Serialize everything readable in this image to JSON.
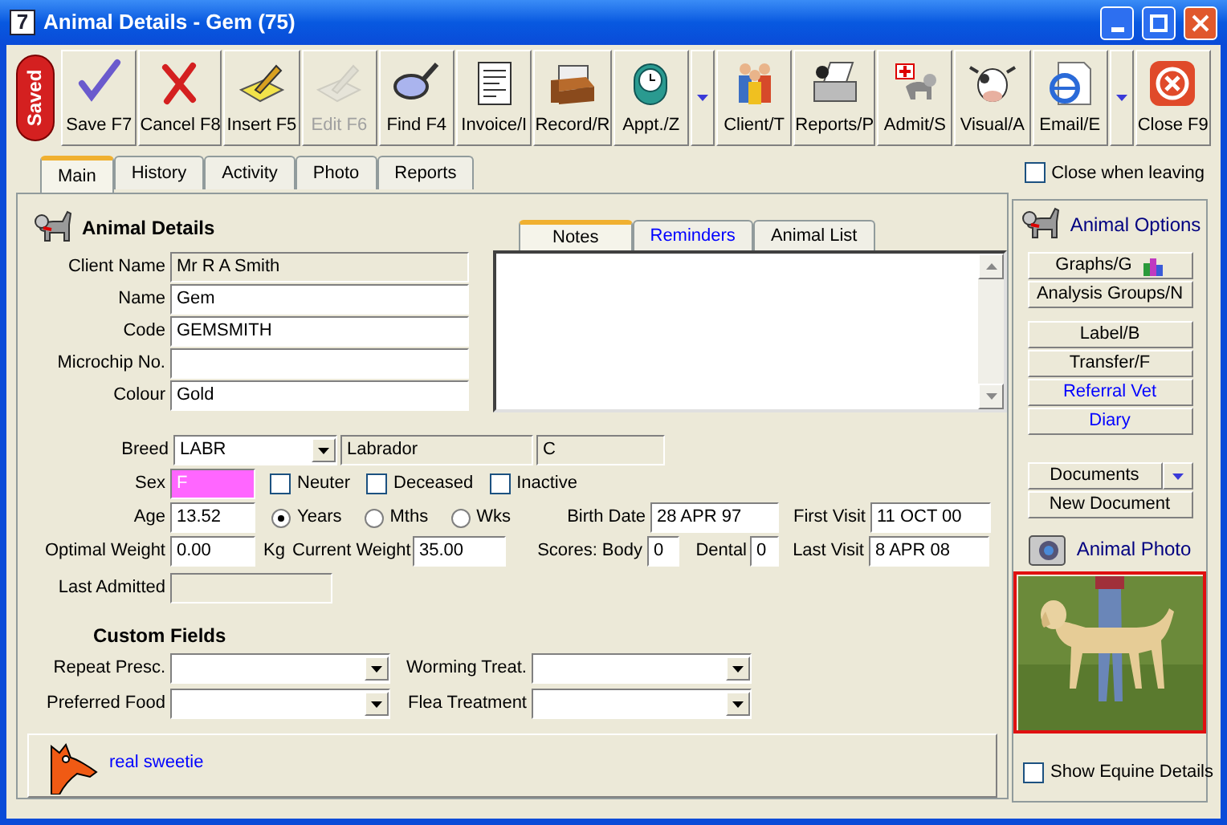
{
  "window": {
    "app_icon": "7",
    "title": "Animal Details - Gem (75)"
  },
  "toolbar": {
    "status": "Saved",
    "buttons": [
      {
        "label": "Save F7",
        "disabled": false,
        "menu": false
      },
      {
        "label": "Cancel F8",
        "disabled": false,
        "menu": false
      },
      {
        "label": "Insert F5",
        "disabled": false,
        "menu": false
      },
      {
        "label": "Edit F6",
        "disabled": true,
        "menu": false
      },
      {
        "label": "Find F4",
        "disabled": false,
        "menu": false
      },
      {
        "label": "Invoice/I",
        "disabled": false,
        "menu": false
      },
      {
        "label": "Record/R",
        "disabled": false,
        "menu": false
      },
      {
        "label": "Appt./Z",
        "disabled": false,
        "menu": true
      },
      {
        "label": "Client/T",
        "disabled": false,
        "menu": false
      },
      {
        "label": "Reports/P",
        "disabled": false,
        "menu": false
      },
      {
        "label": "Admit/S",
        "disabled": false,
        "menu": false
      },
      {
        "label": "Visual/A",
        "disabled": false,
        "menu": false
      },
      {
        "label": "Email/E",
        "disabled": false,
        "menu": true
      },
      {
        "label": "Close F9",
        "disabled": false,
        "menu": false
      }
    ]
  },
  "tabs": [
    {
      "label": "Main",
      "selected": true
    },
    {
      "label": "History",
      "selected": false
    },
    {
      "label": "Activity",
      "selected": false
    },
    {
      "label": "Photo",
      "selected": false
    },
    {
      "label": "Reports",
      "selected": false
    }
  ],
  "close_when_leaving": {
    "label": "Close when leaving",
    "checked": false
  },
  "animal_details": {
    "title": "Animal Details",
    "fields": [
      {
        "label": "Client Name",
        "value": "Mr R A Smith",
        "readonly": true
      },
      {
        "label": "Name",
        "value": "Gem",
        "readonly": false
      },
      {
        "label": "Code",
        "value": "GEMSMITH",
        "readonly": false
      },
      {
        "label": "Microchip No.",
        "readonly": false
      },
      {
        "label": "Colour",
        "value": "Gold",
        "readonly": false
      }
    ]
  },
  "notes": {
    "tabs": [
      {
        "label": "Notes",
        "selected": true,
        "link": false
      },
      {
        "label": "Reminders",
        "selected": false,
        "link": true
      },
      {
        "label": "Animal List",
        "selected": false,
        "link": false
      }
    ]
  },
  "breed": {
    "label": "Breed",
    "code": "LABR",
    "name": "Labrador",
    "group": "C"
  },
  "sex": {
    "label": "Sex",
    "value": "F",
    "female": true
  },
  "flags": [
    {
      "label": "Neuter",
      "checked": false
    },
    {
      "label": "Deceased",
      "checked": false
    },
    {
      "label": "Inactive",
      "checked": false
    }
  ],
  "age": {
    "label": "Age",
    "value": "13.52",
    "units": [
      {
        "label": "Years",
        "selected": true
      },
      {
        "label": "Mths",
        "selected": false
      },
      {
        "label": "Wks",
        "selected": false
      }
    ]
  },
  "birth_date": {
    "label": "Birth Date",
    "value": "28 APR 97"
  },
  "first_visit": {
    "label": "First Visit",
    "value": "11 OCT 00"
  },
  "optimal_weight": {
    "label": "Optimal Weight",
    "value": "0.00",
    "unit": "Kg"
  },
  "current_weight": {
    "label": "Current Weight",
    "value": "35.00"
  },
  "scores": {
    "body_label": "Scores: Body",
    "body": "0",
    "dental_label": "Dental",
    "dental": "0"
  },
  "last_visit": {
    "label": "Last Visit",
    "value": "8 APR 08"
  },
  "last_admitted": {
    "label": "Last Admitted",
    "readonly": true
  },
  "custom_fields": {
    "title": "Custom Fields",
    "fields": [
      {
        "label": "Repeat Presc."
      },
      {
        "label": "Worming Treat."
      },
      {
        "label": "Preferred Food"
      },
      {
        "label": "Flea Treatment"
      }
    ]
  },
  "memo": {
    "text": "real sweetie"
  },
  "options": {
    "title": "Animal Options",
    "groups": [
      {
        "buttons": [
          {
            "label": "Graphs/G",
            "kind": "chart"
          },
          {
            "label": "Analysis Groups/N",
            "kind": "plain"
          }
        ]
      },
      {
        "buttons": [
          {
            "label": "Label/B",
            "kind": "plain"
          },
          {
            "label": "Transfer/F",
            "kind": "plain"
          },
          {
            "label": "Referral Vet",
            "kind": "link"
          },
          {
            "label": "Diary",
            "kind": "link"
          }
        ]
      },
      {
        "buttons": [
          {
            "label": "Documents",
            "kind": "split"
          },
          {
            "label": "New Document",
            "kind": "plain"
          }
        ]
      }
    ]
  },
  "photo": {
    "title": "Animal Photo"
  },
  "show_equine": {
    "label": "Show Equine Details",
    "checked": false
  }
}
